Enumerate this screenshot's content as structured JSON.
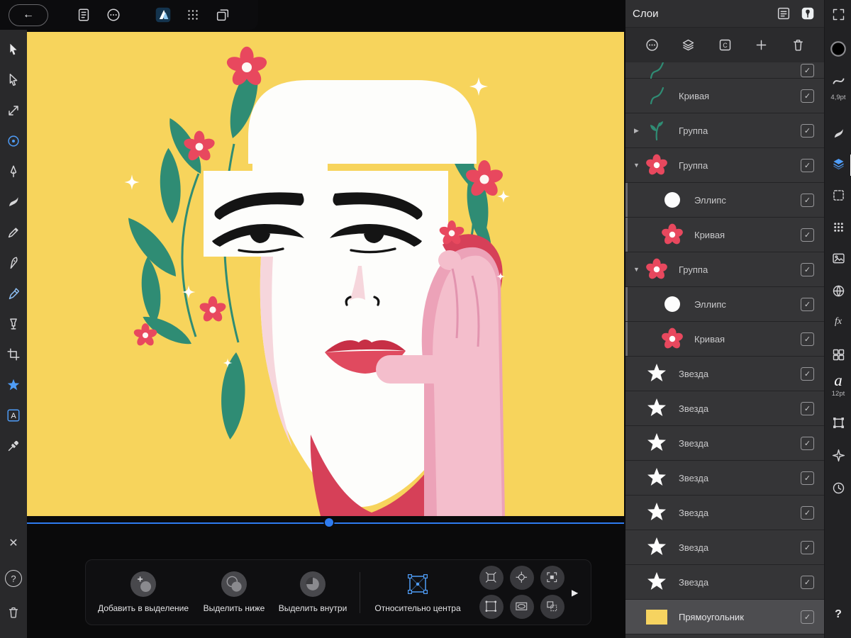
{
  "topbar": {
    "back": "←",
    "icons": [
      {
        "name": "document-icon"
      },
      {
        "name": "more-options-icon"
      },
      {
        "name": "affinity-designer-logo"
      },
      {
        "name": "grid-dots-icon"
      },
      {
        "name": "duplicate-icon"
      }
    ]
  },
  "left_toolbar": {
    "tools": [
      {
        "name": "move-tool"
      },
      {
        "name": "node-tool"
      },
      {
        "name": "transform-tool"
      },
      {
        "name": "point-tool"
      },
      {
        "name": "pen-tool"
      },
      {
        "name": "vector-brush-tool"
      },
      {
        "name": "pencil-tool"
      },
      {
        "name": "fountain-pen-tool"
      },
      {
        "name": "marker-tool"
      },
      {
        "name": "fill-tool"
      },
      {
        "name": "crop-tool"
      },
      {
        "name": "star-shape-tool"
      },
      {
        "name": "text-tool"
      },
      {
        "name": "eyedropper-tool"
      }
    ],
    "bottom": [
      {
        "name": "close-icon",
        "glyph": "✕"
      },
      {
        "name": "help-icon",
        "glyph": "?"
      },
      {
        "name": "delete-icon"
      }
    ]
  },
  "layers_panel": {
    "title": "Слои",
    "header_icons": [
      {
        "name": "list-options-icon"
      },
      {
        "name": "pin-icon"
      }
    ],
    "toolbar_icons": [
      {
        "name": "more-circle-icon"
      },
      {
        "name": "layers-stack-icon"
      },
      {
        "name": "clip-icon"
      },
      {
        "name": "add-layer-icon"
      },
      {
        "name": "delete-layer-icon"
      }
    ],
    "checkmark": "✓",
    "rows": [
      {
        "label": "",
        "thumb": "curve",
        "partial": true,
        "checked": true
      },
      {
        "label": "Кривая",
        "thumb": "curve",
        "checked": true
      },
      {
        "label": "Группа",
        "thumb": "sprout",
        "disclosure": "collapsed",
        "checked": true
      },
      {
        "label": "Группа",
        "thumb": "flower",
        "disclosure": "expanded",
        "checked": true
      },
      {
        "label": "Эллипс",
        "thumb": "ellipse",
        "child": true,
        "checked": true
      },
      {
        "label": "Кривая",
        "thumb": "flower",
        "child": true,
        "checked": true
      },
      {
        "label": "Группа",
        "thumb": "flower",
        "disclosure": "expanded",
        "checked": true
      },
      {
        "label": "Эллипс",
        "thumb": "ellipse",
        "child": true,
        "checked": true
      },
      {
        "label": "Кривая",
        "thumb": "flower",
        "child": true,
        "checked": true
      },
      {
        "label": "Звезда",
        "thumb": "star",
        "checked": true
      },
      {
        "label": "Звезда",
        "thumb": "star",
        "checked": true
      },
      {
        "label": "Звезда",
        "thumb": "star",
        "checked": true
      },
      {
        "label": "Звезда",
        "thumb": "star",
        "checked": true
      },
      {
        "label": "Звезда",
        "thumb": "star",
        "checked": true
      },
      {
        "label": "Звезда",
        "thumb": "star",
        "checked": true
      },
      {
        "label": "Звезда",
        "thumb": "star",
        "checked": true
      },
      {
        "label": "Прямоугольник",
        "thumb": "rect",
        "selected": true,
        "checked": true
      }
    ]
  },
  "right_strip": {
    "items": [
      {
        "name": "expand-panel-icon"
      },
      {
        "name": "stroke-color-well"
      },
      {
        "name": "stroke-style-icon",
        "label": "4,9pt"
      },
      {
        "name": "brush-panel-icon"
      },
      {
        "name": "layers-panel-icon",
        "active": true
      },
      {
        "name": "selection-panel-icon"
      },
      {
        "name": "color-grid-icon"
      },
      {
        "name": "image-panel-icon"
      },
      {
        "name": "globe-panel-icon"
      },
      {
        "name": "fx-panel-icon",
        "glyph": "fx"
      },
      {
        "name": "swatches-panel-icon"
      },
      {
        "name": "typography-panel-icon",
        "glyph": "a",
        "label": "12pt"
      },
      {
        "name": "transform-panel-icon"
      },
      {
        "name": "snapping-panel-icon"
      },
      {
        "name": "history-panel-icon"
      }
    ],
    "help": "?"
  },
  "context_bar": {
    "buttons": [
      {
        "label": "Добавить в выделение",
        "icon": "add-to-selection-icon"
      },
      {
        "label": "Выделить ниже",
        "icon": "select-below-icon"
      },
      {
        "label": "Выделить внутри",
        "icon": "select-inside-icon"
      },
      {
        "label": "Относительно центра",
        "icon": "transform-origin-icon",
        "accent": true
      }
    ],
    "mini_buttons": [
      {
        "name": "scale-handles-icon"
      },
      {
        "name": "crosshair-icon"
      },
      {
        "name": "corner-handles-icon"
      },
      {
        "name": "corner-dots-icon"
      },
      {
        "name": "ellipse-frame-icon"
      },
      {
        "name": "duplicate-frame-icon"
      }
    ],
    "more": "▶"
  },
  "colors": {
    "canvas_yellow": "#F7D45C",
    "accent_blue": "#2E7BF0",
    "flower_red": "#E8485E",
    "leaf_green": "#2F8C74",
    "skin_pink": "#F4BECC",
    "shadow_red": "#D64058"
  }
}
